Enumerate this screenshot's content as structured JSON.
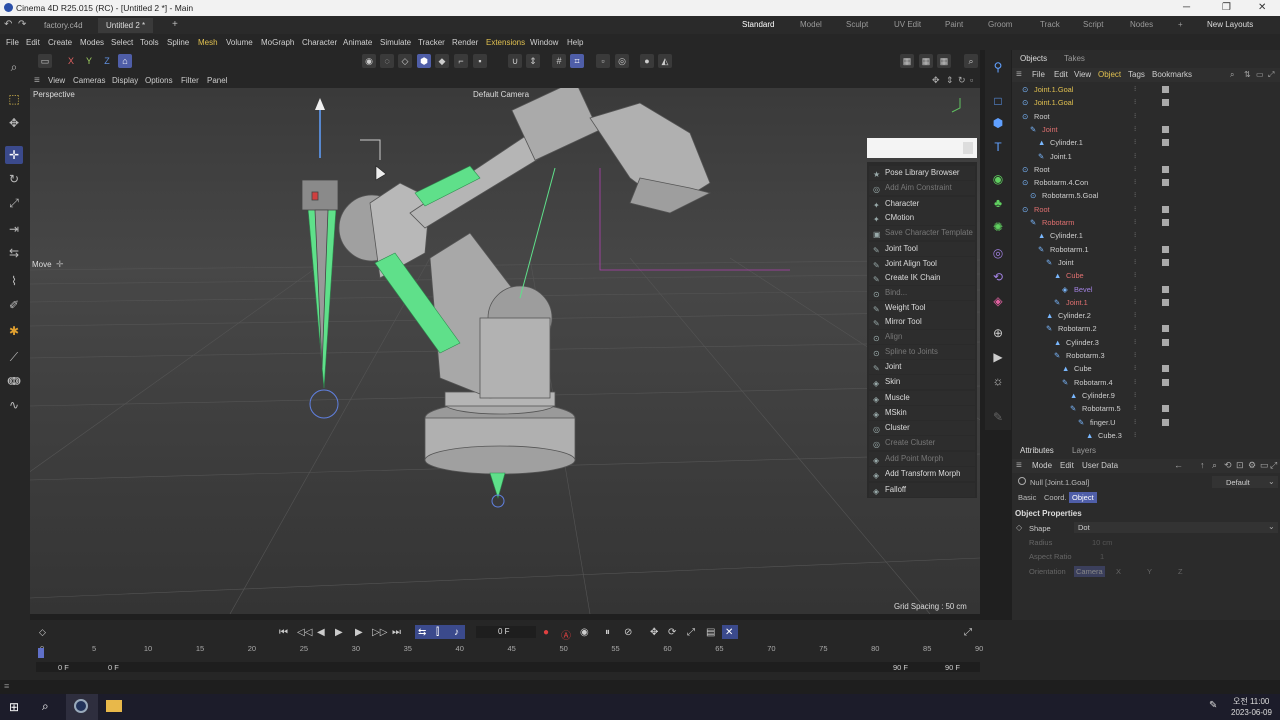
{
  "window": {
    "title": "Cinema 4D R25.015 (RC) - [Untitled 2 *] - Main",
    "min": "─",
    "max": "❐",
    "close": "✕"
  },
  "doc_tabs": [
    "factory.c4d",
    "Untitled 2 *"
  ],
  "new_tab": "+",
  "layouts": [
    "Standard",
    "Model",
    "Sculpt",
    "UV Edit",
    "Paint",
    "Groom",
    "Track",
    "Script",
    "Nodes"
  ],
  "layouts_plus": "+",
  "new_layouts": "New Layouts",
  "menus": [
    "File",
    "Edit",
    "Create",
    "Modes",
    "Select",
    "Tools",
    "Spline",
    "Mesh",
    "Volume",
    "MoGraph",
    "Character",
    "Animate",
    "Simulate",
    "Tracker",
    "Render",
    "Extensions",
    "Window",
    "Help"
  ],
  "toolbar": {
    "x": "X",
    "y": "Y",
    "z": "Z"
  },
  "viewport_menu": [
    "View",
    "Cameras",
    "Display",
    "Options",
    "Filter",
    "Panel"
  ],
  "viewport": {
    "label": "Perspective",
    "camera": "Default Camera",
    "mode_label": "Move",
    "grid_spacing": "Grid Spacing : 50 cm"
  },
  "context_menu": [
    {
      "label": "Pose Library Browser",
      "enabled": true,
      "icon": "★"
    },
    {
      "label": "Add Aim Constraint",
      "enabled": false,
      "icon": "◎"
    },
    {
      "label": "Character",
      "enabled": true,
      "icon": "✦"
    },
    {
      "label": "CMotion",
      "enabled": true,
      "icon": "✦"
    },
    {
      "label": "Save Character Template",
      "enabled": false,
      "icon": "▣"
    },
    {
      "label": "Joint Tool",
      "enabled": true,
      "icon": "✎"
    },
    {
      "label": "Joint Align Tool",
      "enabled": true,
      "icon": "✎"
    },
    {
      "label": "Create IK Chain",
      "enabled": true,
      "icon": "✎"
    },
    {
      "label": "Bind...",
      "enabled": false,
      "icon": "⊙"
    },
    {
      "label": "Weight Tool",
      "enabled": true,
      "icon": "✎"
    },
    {
      "label": "Mirror Tool",
      "enabled": true,
      "icon": "✎"
    },
    {
      "label": "Align",
      "enabled": false,
      "icon": "⊙"
    },
    {
      "label": "Spline to Joints",
      "enabled": false,
      "icon": "⊙"
    },
    {
      "label": "Joint",
      "enabled": true,
      "icon": "✎"
    },
    {
      "label": "Skin",
      "enabled": true,
      "icon": "◈"
    },
    {
      "label": "Muscle",
      "enabled": true,
      "icon": "◈"
    },
    {
      "label": "MSkin",
      "enabled": true,
      "icon": "◈"
    },
    {
      "label": "Cluster",
      "enabled": true,
      "icon": "◎"
    },
    {
      "label": "Create Cluster",
      "enabled": false,
      "icon": "◎"
    },
    {
      "label": "Add Point Morph",
      "enabled": false,
      "icon": "◈"
    },
    {
      "label": "Add Transform Morph",
      "enabled": true,
      "icon": "◈"
    },
    {
      "label": "Falloff",
      "enabled": true,
      "icon": "◈"
    }
  ],
  "objects_panel": {
    "tabs": [
      "Objects",
      "Takes"
    ],
    "menu": [
      "File",
      "Edit",
      "View",
      "Object",
      "Tags",
      "Bookmarks"
    ],
    "rows": [
      {
        "name": "Joint.1.Goal",
        "indent": 0,
        "color": "#e0c050",
        "icon": "⊙"
      },
      {
        "name": "Joint.1.Goal",
        "indent": 0,
        "color": "#e0c050",
        "icon": "⊙"
      },
      {
        "name": "Root",
        "indent": 0,
        "color": "#cfcfcf",
        "icon": "⊙"
      },
      {
        "name": "Joint",
        "indent": 1,
        "color": "#e07070",
        "icon": "✎"
      },
      {
        "name": "Cylinder.1",
        "indent": 2,
        "color": "#cfcfcf",
        "icon": "▲"
      },
      {
        "name": "Joint.1",
        "indent": 2,
        "color": "#cfcfcf",
        "icon": "✎"
      },
      {
        "name": "Root",
        "indent": 0,
        "color": "#cfcfcf",
        "icon": "⊙"
      },
      {
        "name": "Robotarm.4.Con",
        "indent": 0,
        "color": "#cfcfcf",
        "icon": "⊙"
      },
      {
        "name": "Robotarm.5.Goal",
        "indent": 1,
        "color": "#cfcfcf",
        "icon": "⊙"
      },
      {
        "name": "Root",
        "indent": 0,
        "color": "#e07070",
        "icon": "⊙"
      },
      {
        "name": "Robotarm",
        "indent": 1,
        "color": "#e07070",
        "icon": "✎"
      },
      {
        "name": "Cylinder.1",
        "indent": 2,
        "color": "#cfcfcf",
        "icon": "▲"
      },
      {
        "name": "Robotarm.1",
        "indent": 2,
        "color": "#cfcfcf",
        "icon": "✎"
      },
      {
        "name": "Joint",
        "indent": 3,
        "color": "#cfcfcf",
        "icon": "✎"
      },
      {
        "name": "Cube",
        "indent": 4,
        "color": "#e07070",
        "icon": "▲"
      },
      {
        "name": "Bevel",
        "indent": 5,
        "color": "#a080e0",
        "icon": "◈"
      },
      {
        "name": "Joint.1",
        "indent": 4,
        "color": "#e07070",
        "icon": "✎"
      },
      {
        "name": "Cylinder.2",
        "indent": 3,
        "color": "#cfcfcf",
        "icon": "▲"
      },
      {
        "name": "Robotarm.2",
        "indent": 3,
        "color": "#cfcfcf",
        "icon": "✎"
      },
      {
        "name": "Cylinder.3",
        "indent": 4,
        "color": "#cfcfcf",
        "icon": "▲"
      },
      {
        "name": "Robotarm.3",
        "indent": 4,
        "color": "#cfcfcf",
        "icon": "✎"
      },
      {
        "name": "Cube",
        "indent": 5,
        "color": "#cfcfcf",
        "icon": "▲"
      },
      {
        "name": "Robotarm.4",
        "indent": 5,
        "color": "#cfcfcf",
        "icon": "✎"
      },
      {
        "name": "Cylinder.9",
        "indent": 6,
        "color": "#cfcfcf",
        "icon": "▲"
      },
      {
        "name": "Robotarm.5",
        "indent": 6,
        "color": "#cfcfcf",
        "icon": "✎"
      },
      {
        "name": "finger.U",
        "indent": 7,
        "color": "#cfcfcf",
        "icon": "✎"
      },
      {
        "name": "Cube.3",
        "indent": 8,
        "color": "#cfcfcf",
        "icon": "▲"
      }
    ]
  },
  "attributes": {
    "tabs": [
      "Attributes",
      "Layers"
    ],
    "menu": [
      "Mode",
      "Edit",
      "User Data"
    ],
    "object_label": "Null [Joint.1.Goal]",
    "preset": "Default",
    "subtabs": [
      "Basic",
      "Coord.",
      "Object"
    ],
    "section": "Object Properties",
    "shape_label": "Shape",
    "shape_value": "Dot",
    "radius_label": "Radius",
    "radius_value": "10 cm",
    "aspect_label": "Aspect Ratio",
    "aspect_value": "1",
    "orientation_label": "Orientation",
    "orientation_value": "Camera",
    "axes": [
      "X",
      "Y",
      "Z"
    ]
  },
  "timeline": {
    "current_frame": "0 F",
    "ticks": [
      "0",
      "5",
      "10",
      "15",
      "20",
      "25",
      "30",
      "35",
      "40",
      "45",
      "50",
      "55",
      "60",
      "65",
      "70",
      "75",
      "80",
      "85",
      "90"
    ],
    "start": "0 F",
    "start2": "0 F",
    "end": "90 F",
    "end2": "90 F"
  },
  "taskbar": {
    "time": "오전 11:00",
    "date": "2023-06-09"
  },
  "colors": {
    "accent": "#4f5ea8",
    "joint_green": "#5fe08a",
    "viewport_bg": "#3c3c3c",
    "panel_bg": "#2b2b2b"
  }
}
